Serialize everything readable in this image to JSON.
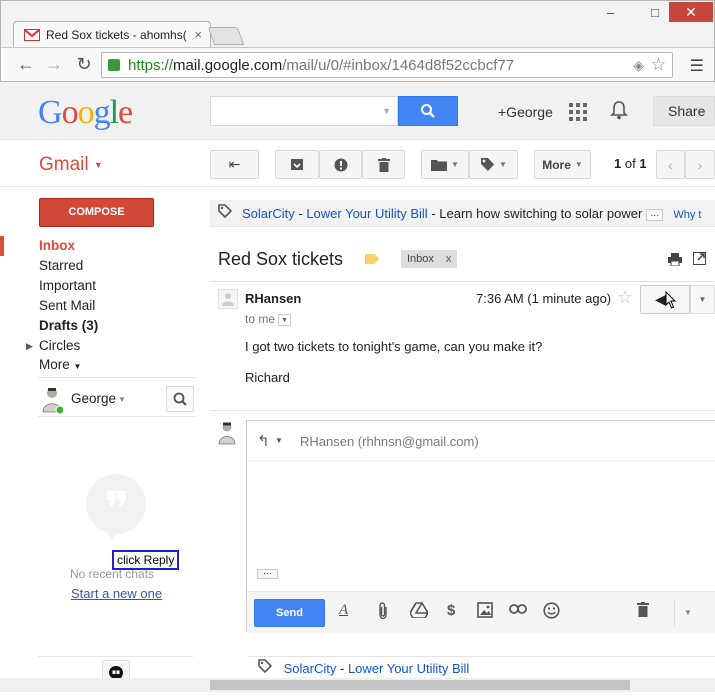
{
  "browser": {
    "tab_title": "Red Sox tickets - ahomhs(",
    "tab_close": "×",
    "url_scheme": "https://",
    "url_host": "mail.google.com",
    "url_path": "/mail/u/0/#inbox/1464d8f52ccbcf77",
    "back": "←",
    "forward": "→",
    "reload": "↻",
    "minimize": "–",
    "maximize": "□",
    "close": "✕"
  },
  "google_header": {
    "logo_letters": [
      "G",
      "o",
      "o",
      "g",
      "l",
      "e"
    ],
    "logo_colors": [
      "#4285f4",
      "#dd4b39",
      "#f4b400",
      "#4285f4",
      "#0f9d58",
      "#dd4b39"
    ],
    "search_placeholder": "",
    "plus_user": "+George",
    "share": "Share"
  },
  "gmail_bar": {
    "label": "Gmail",
    "caret": "▼",
    "more": "More",
    "pager_current": "1",
    "pager_of": "of",
    "pager_total": "1"
  },
  "sidebar": {
    "compose": "COMPOSE",
    "items": [
      {
        "label": "Inbox"
      },
      {
        "label": "Starred"
      },
      {
        "label": "Important"
      },
      {
        "label": "Sent Mail"
      },
      {
        "label": "Drafts (3)"
      },
      {
        "label": "Circles"
      },
      {
        "label": "More"
      }
    ],
    "hangouts_user": "George",
    "no_recent": "No recent chats",
    "start_new": "Start a new one",
    "tooltip": "click Reply"
  },
  "ad": {
    "advertiser": "SolarCity",
    "separator": " - ",
    "headline": "Lower Your Utility Bill",
    "description": " - Learn how switching to solar power",
    "dots": "···",
    "why": "Why t"
  },
  "thread": {
    "subject": "Red Sox tickets",
    "label": "Inbox",
    "label_remove": "x",
    "sender": "RHansen",
    "time": "7:36 AM (1 minute ago)",
    "to": "to me",
    "body_line1": "I got two tickets to tonight's game, can you make it?",
    "body_line2": "Richard"
  },
  "composer": {
    "to": "RHansen (rhhnsn@gmail.com)",
    "dots": "···",
    "send": "Send",
    "format": "A"
  },
  "ad2": {
    "advertiser": "SolarCity",
    "separator": " - ",
    "headline": "Lower Your Utility Bill"
  },
  "colors": {
    "gmail_red": "#dd4b39",
    "compose_red": "#d14836",
    "search_blue": "#4285f4",
    "link_blue": "#1155cc"
  }
}
